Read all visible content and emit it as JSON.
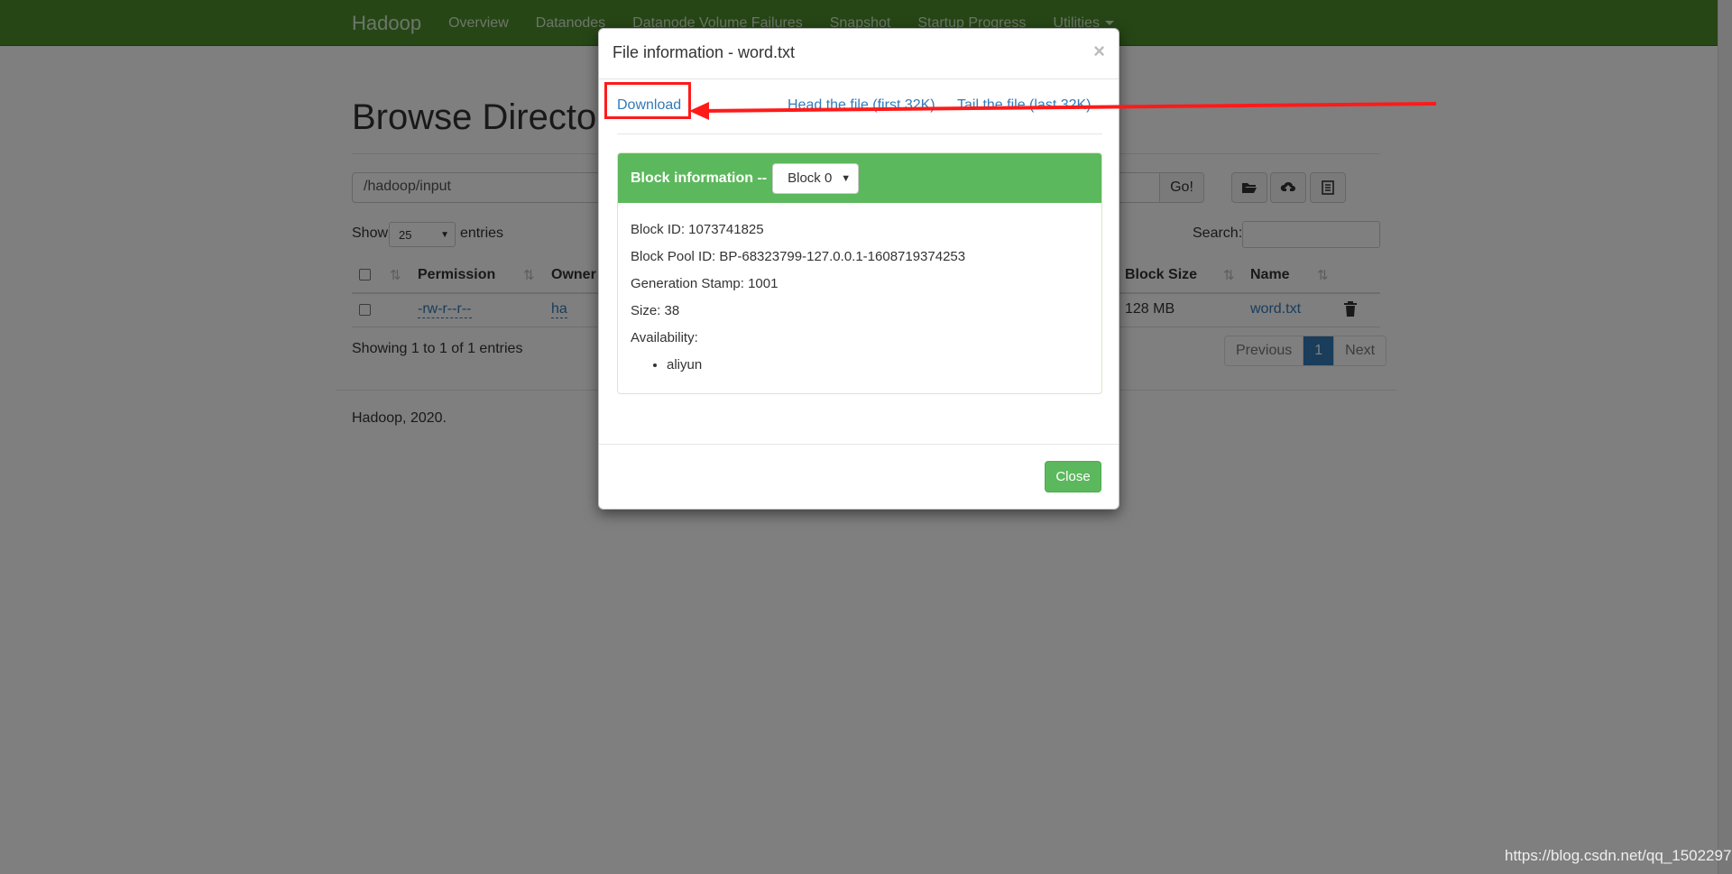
{
  "navbar": {
    "brand": "Hadoop",
    "items": [
      "Overview",
      "Datanodes",
      "Datanode Volume Failures",
      "Snapshot",
      "Startup Progress",
      "Utilities"
    ],
    "bg_color": "#4d8d2d"
  },
  "page": {
    "title": "Browse Directory",
    "path_value": "/hadoop/input",
    "go_label": "Go!",
    "tool_icons": [
      "folder-open-icon",
      "cloud-upload-icon",
      "list-icon"
    ],
    "show_label": "Show",
    "page_size": "25",
    "entries_label": "entries",
    "search_label": "Search:",
    "columns": [
      "Permission",
      "Owner",
      "Block Size",
      "Name"
    ],
    "row": {
      "permission": "-rw-r--r--",
      "owner": "ha",
      "block_size": "128 MB",
      "name": "word.txt"
    },
    "showing": "Showing 1 to 1 of 1 entries",
    "pager": {
      "previous": "Previous",
      "current": "1",
      "next": "Next"
    },
    "footer": "Hadoop, 2020."
  },
  "modal": {
    "title": "File information - word.txt",
    "close_x": "×",
    "links": {
      "download": "Download",
      "head": "Head the file (first 32K)",
      "tail": "Tail the file (last 32K)"
    },
    "block": {
      "heading": "Block information --",
      "selected": "Block 0",
      "block_id": "Block ID: 1073741825",
      "pool_id": "Block Pool ID: BP-68323799-127.0.0.1-1608719374253",
      "generation_stamp": "Generation Stamp: 1001",
      "size": "Size: 38",
      "availability_label": "Availability:",
      "availability": [
        "aliyun"
      ]
    },
    "close_label": "Close",
    "accent_color": "#5cb85c"
  },
  "watermark": "https://blog.csdn.net/qq_1502297",
  "annotation_color": "#ff1a1a"
}
